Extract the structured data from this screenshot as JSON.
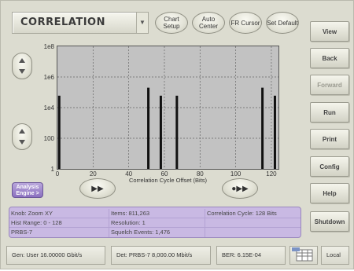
{
  "title": "CORRELATION",
  "top_buttons": [
    "Chart Setup",
    "Auto Center",
    "FR Cursor",
    "Set Default"
  ],
  "side_buttons": [
    {
      "label": "View",
      "enabled": true
    },
    {
      "label": "Back",
      "enabled": true
    },
    {
      "label": "Forward",
      "enabled": false
    },
    {
      "label": "Run",
      "enabled": true
    },
    {
      "label": "Print",
      "enabled": true
    },
    {
      "label": "Config",
      "enabled": true
    },
    {
      "label": "Help",
      "enabled": true
    },
    {
      "label": "Shutdown",
      "enabled": true
    }
  ],
  "analysis_button": "Analysis Engine >",
  "bottom_buttons": [
    "▶▶",
    "●▶▶"
  ],
  "info": {
    "knob": "Knob:  Zoom XY",
    "hist_range": "Hist Range: 0 - 128",
    "prbs": "PRBS-7",
    "items": "Items: 811,263",
    "resolution": "Resolution: 1",
    "squelch": "Squelch Events: 1,476",
    "cycle": "Correlation Cycle: 128 Bits"
  },
  "status": {
    "gen": "Gen: User 16.00000 Gbit/s",
    "det": "Det: PRBS-7 8,000.00 Mbit/s",
    "ber": "BER: 6.15E-04",
    "mode": "Local"
  },
  "chart_data": {
    "type": "bar",
    "xlabel": "Correlation Cycle Offset (Bits)",
    "ylabel": "",
    "xlim": [
      0,
      124
    ],
    "ylim": [
      1,
      100000000
    ],
    "yscale": "log",
    "grid": true,
    "x_ticks": [
      0,
      20,
      40,
      60,
      80,
      100,
      120
    ],
    "y_ticks": [
      1,
      100,
      10000,
      1000000,
      100000000
    ],
    "y_tick_labels": [
      "1",
      "100",
      "1e4",
      "1e6",
      "1e8"
    ],
    "bars": [
      {
        "x": 1,
        "y": 60000
      },
      {
        "x": 51,
        "y": 200000
      },
      {
        "x": 58,
        "y": 60000
      },
      {
        "x": 67,
        "y": 60000
      },
      {
        "x": 115,
        "y": 200000
      },
      {
        "x": 122,
        "y": 60000
      }
    ]
  },
  "colors": {
    "plot_bg": "#c2c2c2",
    "bar": "#111111",
    "panel": "#c9b9e3"
  }
}
